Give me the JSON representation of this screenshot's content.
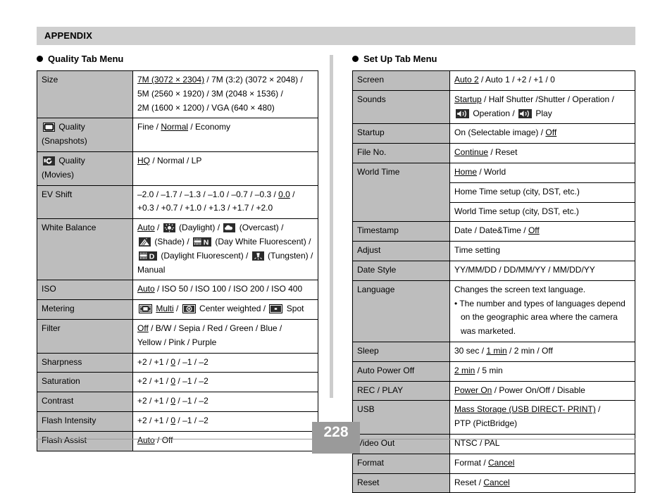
{
  "header": {
    "title": "APPENDIX"
  },
  "footer": {
    "page_number": "228"
  },
  "left": {
    "section_title": "Quality Tab Menu",
    "rows": [
      {
        "key": "Size",
        "key_icon": null,
        "key_sub": null,
        "lines": [
          "7M (3072 × 2304) / 7M (3:2) (3072 × 2048) /",
          "5M (2560 × 1920) / 3M (2048 × 1536) /",
          "2M (1600 × 1200) / VGA (640 × 480)"
        ],
        "underlined": "7M (3072 × 2304)"
      },
      {
        "key": "Quality",
        "key_icon": "snapshot-icon",
        "key_sub": "(Snapshots)",
        "lines": [
          "Fine / Normal / Economy"
        ],
        "underlined": "Normal"
      },
      {
        "key": "Quality",
        "key_icon": "movie-icon",
        "key_sub": "(Movies)",
        "lines": [
          "HQ / Normal / LP"
        ],
        "underlined": "HQ"
      },
      {
        "key": "EV Shift",
        "key_icon": null,
        "key_sub": null,
        "lines": [
          "–2.0 / –1.7 / –1.3 / –1.0 / –0.7 / –0.3 / 0.0 /",
          "+0.3 / +0.7 / +1.0 / +1.3 / +1.7 / +2.0"
        ],
        "underlined": "0.0"
      },
      {
        "key": "White Balance",
        "key_icon": null,
        "key_sub": null,
        "lines": [
          "Auto / [daylight-icon] (Daylight) / [overcast-icon] (Overcast) /",
          "[shade-icon] (Shade) / [day-white-fluorescent-icon] (Day White Fluorescent) /",
          "[daylight-fluorescent-icon] (Daylight Fluorescent) / [tungsten-icon] (Tungsten) /",
          "Manual"
        ],
        "underlined": "Auto"
      },
      {
        "key": "ISO",
        "key_icon": null,
        "key_sub": null,
        "lines": [
          "Auto / ISO 50 / ISO 100 / ISO 200 / ISO 400"
        ],
        "underlined": "Auto"
      },
      {
        "key": "Metering",
        "key_icon": null,
        "key_sub": null,
        "lines": [
          "[multi-metering-icon] Multi / [center-weighted-icon] Center weighted / [spot-metering-icon] Spot"
        ],
        "underlined": "Multi"
      },
      {
        "key": "Filter",
        "key_icon": null,
        "key_sub": null,
        "lines": [
          "Off / B/W / Sepia / Red / Green / Blue /",
          "Yellow / Pink / Purple"
        ],
        "underlined": "Off"
      },
      {
        "key": "Sharpness",
        "key_icon": null,
        "key_sub": null,
        "lines": [
          "+2 / +1 / 0 / –1 / –2"
        ],
        "underlined": "0"
      },
      {
        "key": "Saturation",
        "key_icon": null,
        "key_sub": null,
        "lines": [
          "+2 / +1 / 0 / –1 / –2"
        ],
        "underlined": "0"
      },
      {
        "key": "Contrast",
        "key_icon": null,
        "key_sub": null,
        "lines": [
          "+2 / +1 / 0 / –1 / –2"
        ],
        "underlined": "0"
      },
      {
        "key": "Flash Intensity",
        "key_icon": null,
        "key_sub": null,
        "lines": [
          "+2 / +1 / 0 / –1 / –2"
        ],
        "underlined": "0"
      },
      {
        "key": "Flash Assist",
        "key_icon": null,
        "key_sub": null,
        "lines": [
          "Auto / Off"
        ],
        "underlined": "Auto"
      }
    ]
  },
  "right": {
    "section_title": "Set Up Tab Menu",
    "rows": [
      {
        "key": "Screen",
        "lines": [
          "Auto 2 / Auto 1 / +2 / +1 / 0"
        ],
        "underlined": "Auto 2"
      },
      {
        "key": "Sounds",
        "lines": [
          "Startup / Half Shutter /Shutter / Operation /",
          "[speaker-icon] Operation / [speaker-icon] Play"
        ],
        "underlined": "Startup"
      },
      {
        "key": "Startup",
        "lines": [
          "On (Selectable image) / Off"
        ],
        "underlined": "Off"
      },
      {
        "key": "File No.",
        "lines": [
          "Continue / Reset"
        ],
        "underlined": "Continue"
      },
      {
        "key": "World Time",
        "lines": [
          "Home / World"
        ],
        "underlined": "Home",
        "extra_rows": [
          "Home Time setup (city, DST, etc.)",
          "World Time setup (city, DST, etc.)"
        ]
      },
      {
        "key": "Timestamp",
        "lines": [
          "Date / Date&Time / Off"
        ],
        "underlined": "Off"
      },
      {
        "key": "Adjust",
        "lines": [
          "Time setting"
        ],
        "underlined": null
      },
      {
        "key": "Date Style",
        "lines": [
          "YY/MM/DD / DD/MM/YY / MM/DD/YY"
        ],
        "underlined": null
      },
      {
        "key": "Language",
        "lines": [
          "Changes the screen text language.",
          "• The number and types of languages depend",
          "on the geographic area where the camera",
          "was marketed."
        ],
        "underlined": null
      },
      {
        "key": "Sleep",
        "lines": [
          "30 sec / 1 min / 2 min / Off"
        ],
        "underlined": "1 min"
      },
      {
        "key": "Auto Power Off",
        "lines": [
          "2 min / 5 min"
        ],
        "underlined": "2 min"
      },
      {
        "key": "REC / PLAY",
        "lines": [
          "Power On / Power On/Off / Disable"
        ],
        "underlined": "Power On"
      },
      {
        "key": "USB",
        "lines": [
          "Mass Storage (USB DIRECT- PRINT) /",
          "PTP (PictBridge)"
        ],
        "underlined": "Mass Storage (USB DIRECT- PRINT)"
      },
      {
        "key": "Video Out",
        "lines": [
          "NTSC / PAL"
        ],
        "underlined": null
      },
      {
        "key": "Format",
        "lines": [
          "Format / Cancel"
        ],
        "underlined": "Cancel"
      },
      {
        "key": "Reset",
        "lines": [
          "Reset / Cancel"
        ],
        "underlined": "Cancel"
      }
    ]
  },
  "colors": {
    "header_bar": "#cfcfcf",
    "key_cell": "#bdbdbd",
    "divider": "#cccccc",
    "footer": "#9a9a9a",
    "text": "#000000"
  }
}
